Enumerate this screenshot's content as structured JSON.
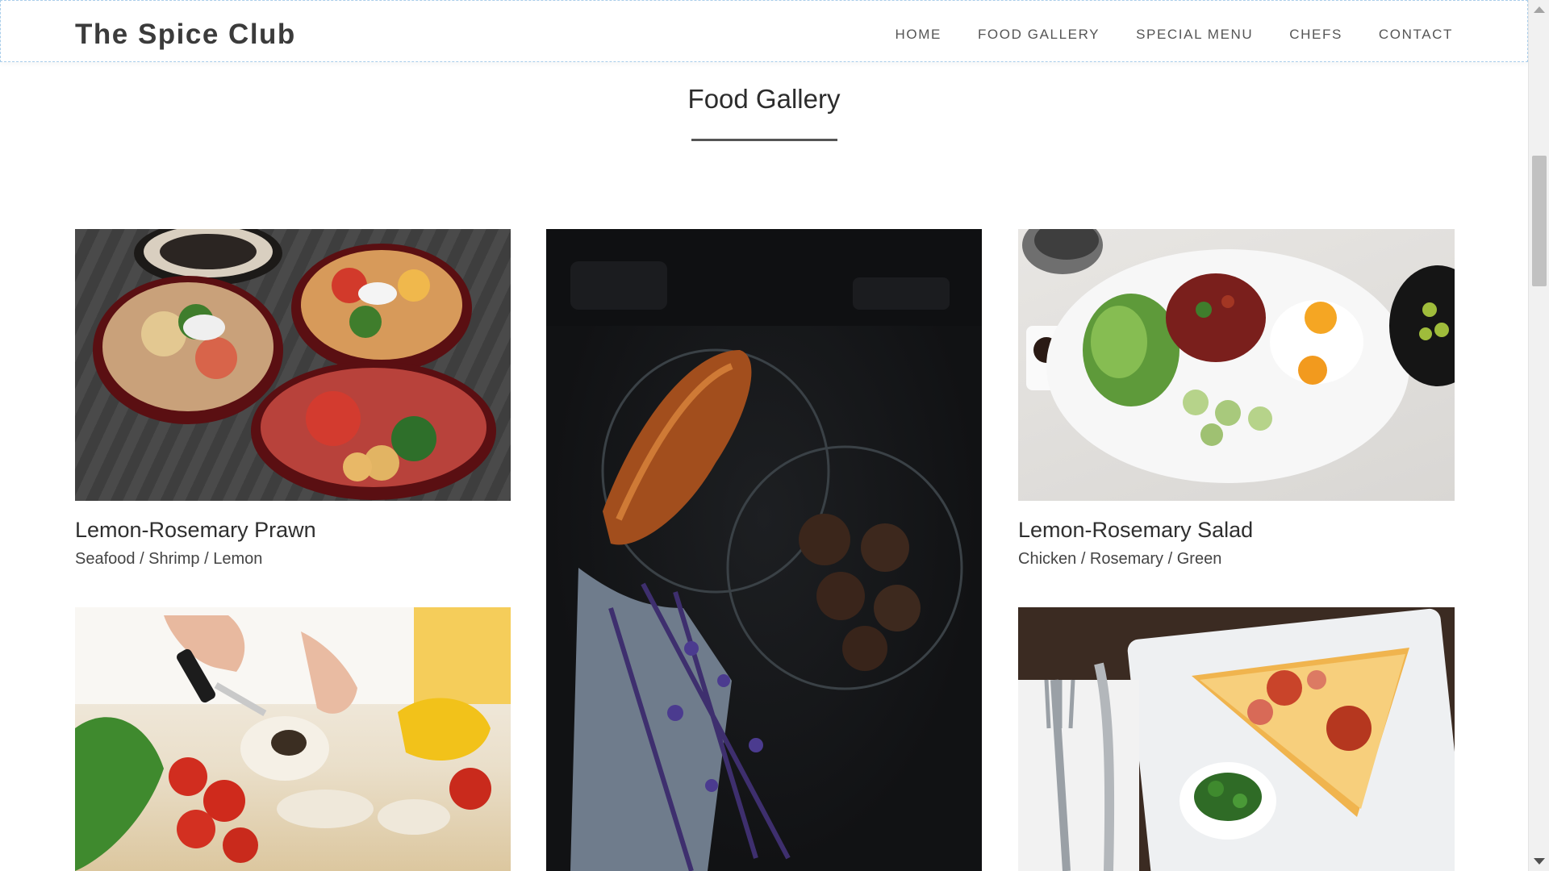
{
  "brand": "The Spice Club",
  "nav": [
    "HOME",
    "FOOD GALLERY",
    "SPECIAL MENU",
    "CHEFS",
    "CONTACT"
  ],
  "section": {
    "title": "Food Gallery"
  },
  "gallery": [
    {
      "title": "Lemon-Rosemary Prawn",
      "tags": "Seafood / Shrimp / Lemon",
      "image": "party-platters"
    },
    {
      "title": "",
      "tags": "",
      "image": "croissant-dark"
    },
    {
      "title": "Lemon-Rosemary Salad",
      "tags": "Chicken / Rosemary / Green",
      "image": "salad-plate"
    },
    {
      "title": "",
      "tags": "",
      "image": "chopping-vegetables"
    },
    {
      "title": "",
      "tags": "",
      "image": "pizza-slice"
    }
  ],
  "colors": {
    "text": "#333333",
    "underline": "#555555",
    "border": "#a9cdea"
  }
}
